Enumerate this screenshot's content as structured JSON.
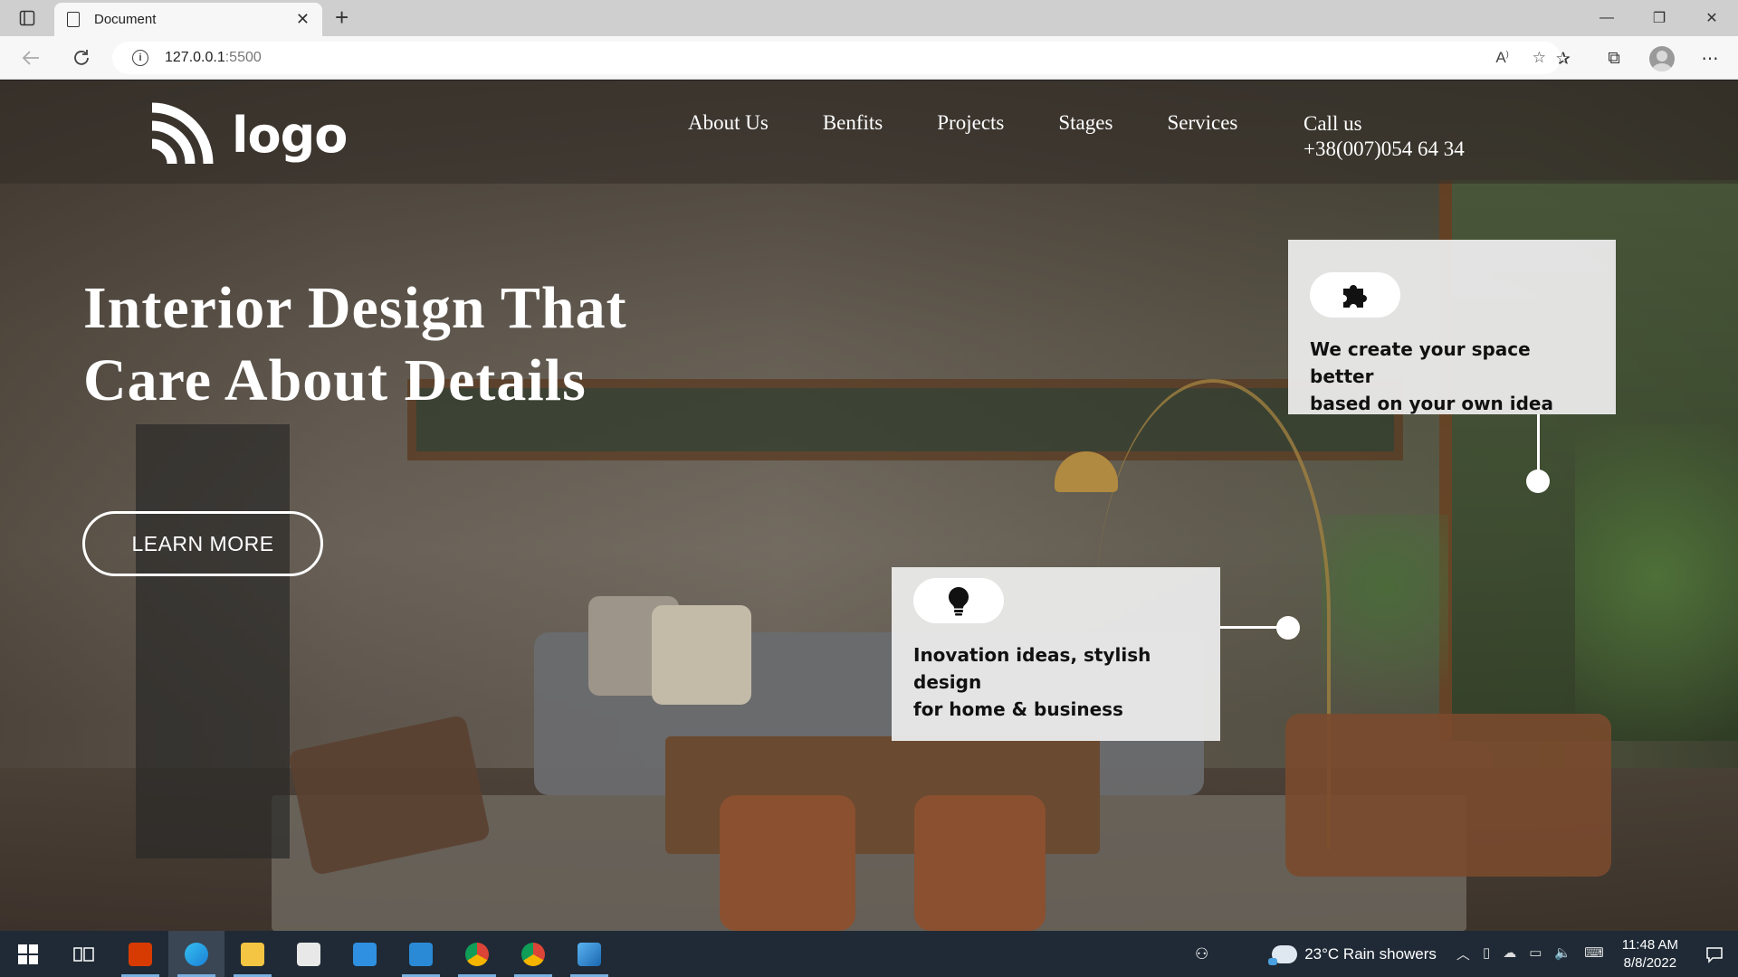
{
  "browser": {
    "tab_title": "Document",
    "tab_close": "✕",
    "new_tab": "+",
    "url_host": "127.0.0.1",
    "url_port": ":5500",
    "window_controls": [
      "—",
      "❐",
      "✕"
    ]
  },
  "site": {
    "logo_text": "logo",
    "nav": [
      "About Us",
      "Benfits",
      "Projects",
      "Stages",
      "Services"
    ],
    "call_label": "Call us",
    "call_number": "+38(007)054 64 34",
    "hero_line1": "Interior Design That",
    "hero_line2": "Care About Details",
    "learn_more": "LEARN MORE",
    "card1_line1": "We create your space better",
    "card1_line2": "based on your own idea",
    "card2_line1": "Inovation ideas, stylish",
    "card2_line2": "design",
    "card2_line3": "for home & business"
  },
  "taskbar": {
    "weather": "23°C  Rain showers",
    "time": "11:48 AM",
    "date": "8/8/2022"
  },
  "colors": {
    "card_bg": "#ebebeb",
    "taskbar_bg": "#1f2a36",
    "text_on_hero": "#ffffff"
  }
}
